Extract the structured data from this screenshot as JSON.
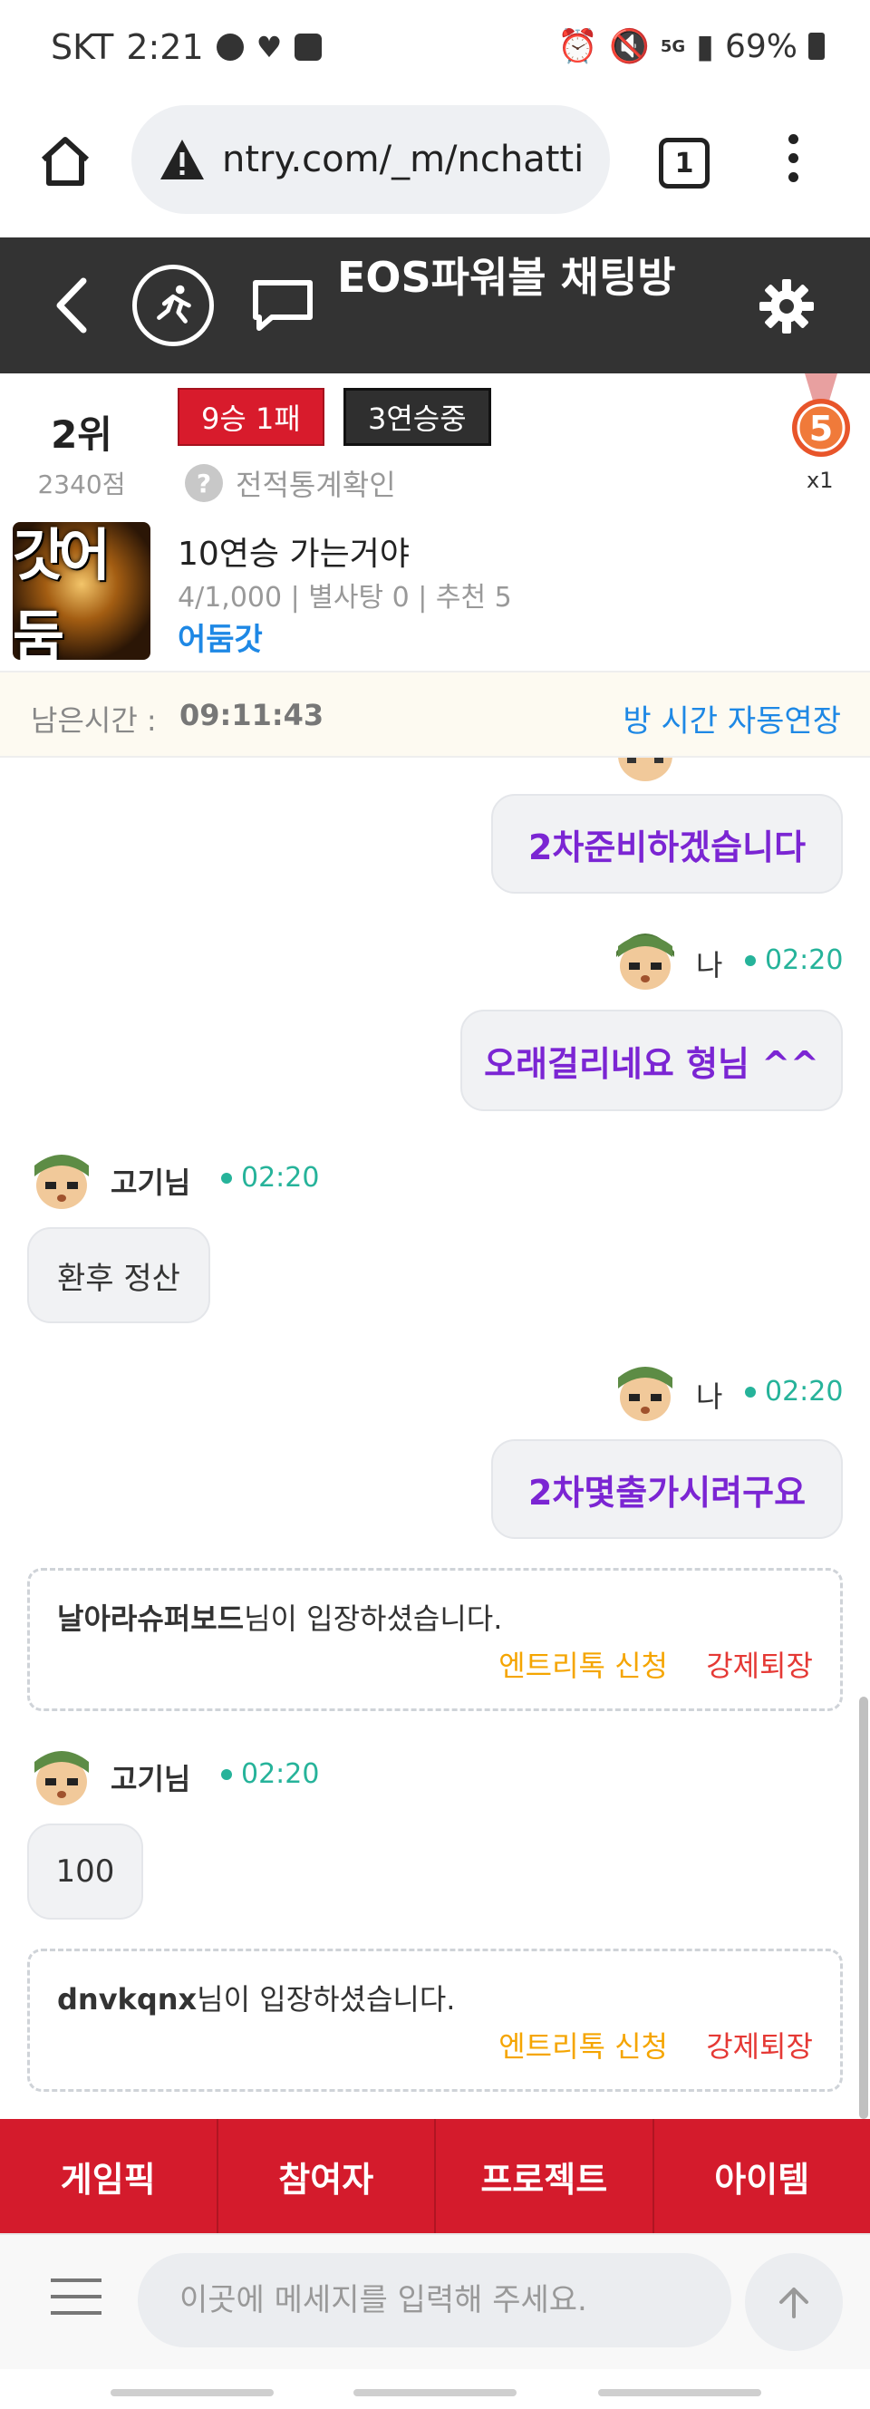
{
  "status_bar": {
    "carrier": "SKT",
    "time": "2:21",
    "battery": "69%",
    "network": "5G"
  },
  "browser": {
    "url": "ntry.com/_m/nchatti",
    "tab_count": "1"
  },
  "header": {
    "title": "EOS파워볼 채팅방"
  },
  "room": {
    "rank": "2위",
    "points": "2340점",
    "record": "9승 1패",
    "streak": "3연승중",
    "stats_link": "전적통계확인",
    "medal_level": "5",
    "medal_count": "x1",
    "avatar_text": "갓어둠",
    "name": "10연승 가는거야",
    "meta": "4/1,000 | 별사탕 0 | 추천 5",
    "owner": "어둠갓"
  },
  "timebar": {
    "label": "남은시간 :",
    "value": "09:11:43",
    "extend": "방 시간 자동연장"
  },
  "chat": {
    "messages": [
      {
        "type": "mine",
        "text": "2차준비하겠습니다"
      },
      {
        "type": "mine",
        "name": "나",
        "time": "02:20",
        "text": "오래걸리네요 형님 ^^"
      },
      {
        "type": "other",
        "name": "고기님",
        "time": "02:20",
        "text": "환후 정산"
      },
      {
        "type": "mine",
        "name": "나",
        "time": "02:20",
        "text": "2차몇출가시려구요"
      },
      {
        "type": "system",
        "user": "날아라슈퍼보드",
        "text": "님이 입장하셨습니다.",
        "entry": "엔트리톡 신청",
        "kick": "강제퇴장"
      },
      {
        "type": "other",
        "name": "고기님",
        "time": "02:20",
        "text": "100"
      },
      {
        "type": "system",
        "user": "dnvkqnx",
        "text": "님이 입장하셨습니다.",
        "entry": "엔트리톡 신청",
        "kick": "강제퇴장"
      }
    ]
  },
  "tabs": [
    "게임픽",
    "참여자",
    "프로젝트",
    "아이템"
  ],
  "input": {
    "placeholder": "이곳에 메세지를 입력해 주세요."
  },
  "colors": {
    "header_bg": "#333333",
    "accent_red": "#d41b2c",
    "my_text": "#7b25d3",
    "time_green": "#26b39a",
    "link_blue": "#1e88e5",
    "entry_orange": "#f5a500"
  }
}
